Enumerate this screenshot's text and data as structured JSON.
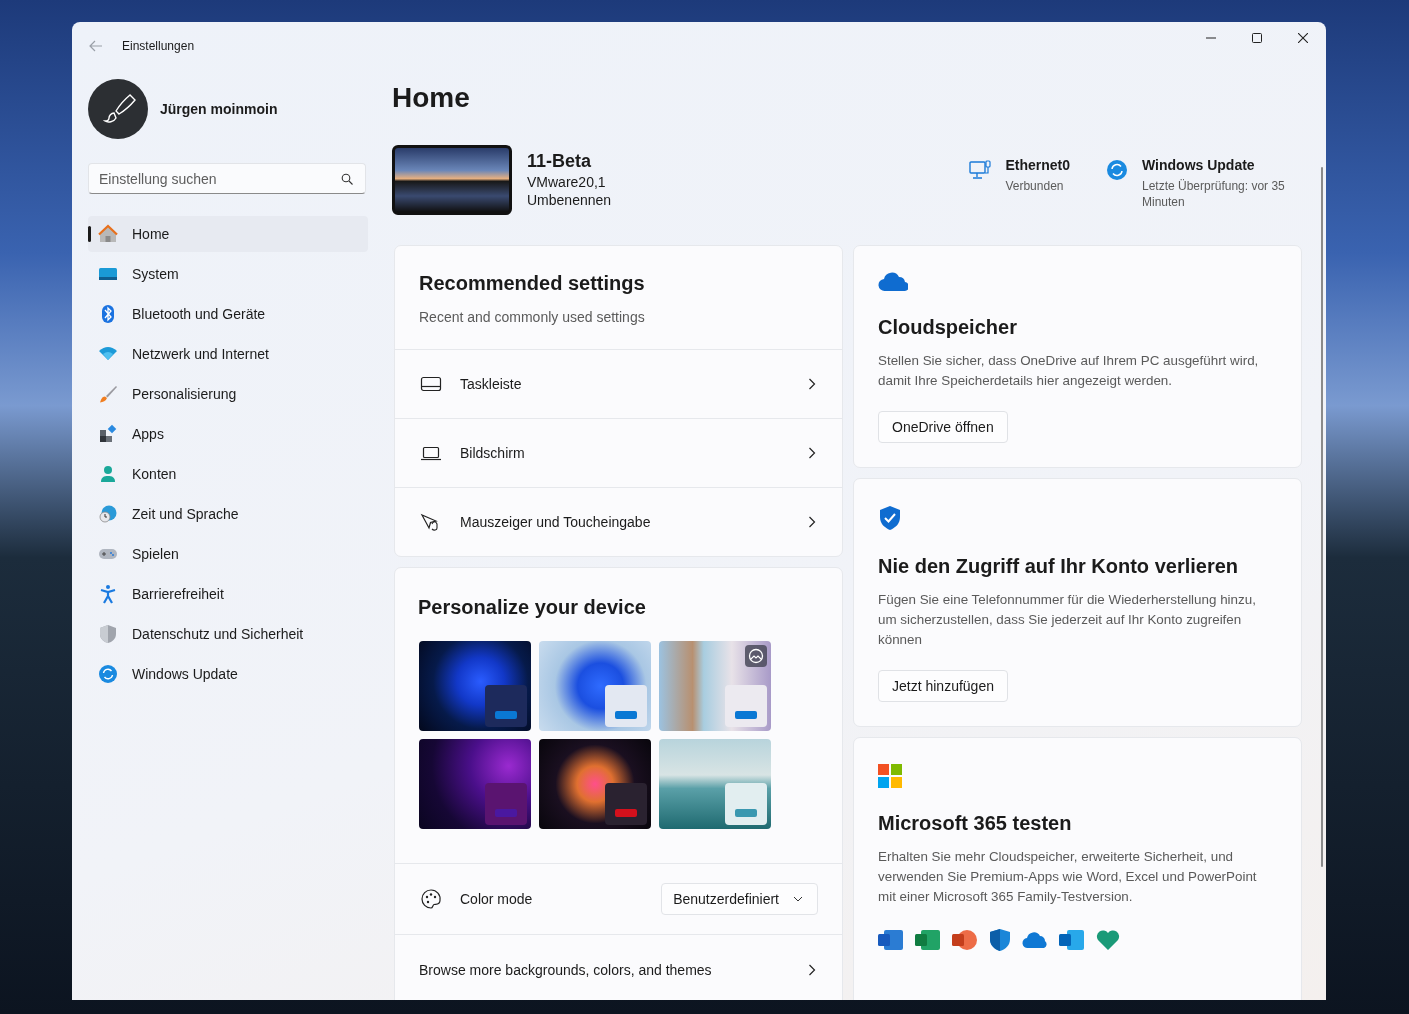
{
  "window": {
    "title": "Einstellungen"
  },
  "user": {
    "name": "Jürgen moinmoin"
  },
  "search": {
    "placeholder": "Einstellung suchen"
  },
  "nav": [
    {
      "label": "Home",
      "kind": "home",
      "selected": true
    },
    {
      "label": "System",
      "kind": "system",
      "selected": false
    },
    {
      "label": "Bluetooth und Geräte",
      "kind": "bluetooth",
      "selected": false
    },
    {
      "label": "Netzwerk und Internet",
      "kind": "wifi",
      "selected": false
    },
    {
      "label": "Personalisierung",
      "kind": "brush",
      "selected": false
    },
    {
      "label": "Apps",
      "kind": "apps",
      "selected": false
    },
    {
      "label": "Konten",
      "kind": "person",
      "selected": false
    },
    {
      "label": "Zeit und Sprache",
      "kind": "globe",
      "selected": false
    },
    {
      "label": "Spielen",
      "kind": "gamepad",
      "selected": false
    },
    {
      "label": "Barrierefreiheit",
      "kind": "accessibility",
      "selected": false
    },
    {
      "label": "Datenschutz und Sicherheit",
      "kind": "shield",
      "selected": false
    },
    {
      "label": "Windows Update",
      "kind": "update",
      "selected": false
    }
  ],
  "page_title": "Home",
  "device": {
    "name": "11-Beta",
    "model": "VMware20,1",
    "rename": "Umbenennen"
  },
  "status": [
    {
      "kind": "network",
      "title": "Ethernet0",
      "subtitle": "Verbunden"
    },
    {
      "kind": "update",
      "title": "Windows Update",
      "subtitle": "Letzte Überprüfung: vor 35 Minuten"
    }
  ],
  "recommended": {
    "title": "Recommended settings",
    "subtitle": "Recent and commonly used settings",
    "items": [
      {
        "label": "Taskleiste",
        "kind": "taskbar"
      },
      {
        "label": "Bildschirm",
        "kind": "laptop"
      },
      {
        "label": "Mauszeiger und Toucheingabe",
        "kind": "pointer"
      }
    ]
  },
  "personalize": {
    "title": "Personalize your device",
    "color_mode": {
      "label": "Color mode",
      "value": "Benutzerdefiniert"
    },
    "browse": "Browse more backgrounds, colors, and themes"
  },
  "cards": [
    {
      "kind": "onedrive",
      "title": "Cloudspeicher",
      "text": "Stellen Sie sicher, dass OneDrive auf Ihrem PC ausgeführt wird, damit Ihre Speicherdetails hier angezeigt werden.",
      "button": "OneDrive öffnen"
    },
    {
      "kind": "account",
      "title": "Nie den Zugriff auf Ihr Konto verlieren",
      "text": "Fügen Sie eine Telefonnummer für die Wiederherstellung hinzu, um sicherzustellen, dass Sie jederzeit auf Ihr Konto zugreifen können",
      "button": "Jetzt hinzufügen"
    },
    {
      "kind": "m365",
      "title": "Microsoft 365 testen",
      "text": "Erhalten Sie mehr Cloudspeicher, erweiterte Sicherheit, und verwenden Sie Premium-Apps wie Word, Excel und PowerPoint mit einer Microsoft 365 Family-Testversion."
    }
  ]
}
